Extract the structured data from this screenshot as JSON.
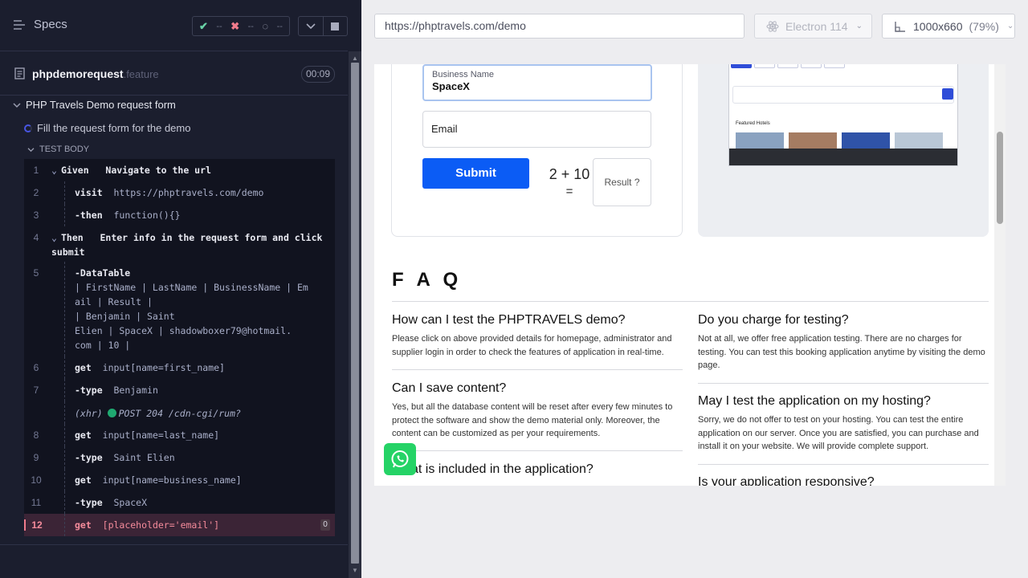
{
  "runner": {
    "specs_label": "Specs",
    "stats": {
      "passed": "--",
      "failed": "--",
      "pending": "--"
    },
    "spec": {
      "name": "phpdemorequest",
      "ext": ".feature",
      "time": "00:09"
    },
    "suite_title": "PHP Travels Demo request form",
    "test_title": "Fill the request form for the demo",
    "body_label": "TEST BODY",
    "commands": [
      {
        "num": "1",
        "kw": "Given",
        "text": "Navigate to the url"
      },
      {
        "num": "2",
        "kw": "visit",
        "text": "https://phptravels.com/demo"
      },
      {
        "num": "3",
        "kw": "-then",
        "text": "function(){}"
      },
      {
        "num": "4",
        "kw": "Then",
        "text": "Enter info in the request form and click",
        "text2": "submit"
      },
      {
        "num": "5",
        "kw": "-DataTable",
        "lines": [
          "| FirstName | LastName    | BusinessName | Em",
          "ail                      | Result |",
          "| Benjamin  | Saint",
          "Elien | SpaceX       | shadowboxer79@hotmail.",
          "com | 10     |"
        ]
      },
      {
        "num": "6",
        "kw": "get",
        "text": "input[name=first_name]"
      },
      {
        "num": "7",
        "kw": "-type",
        "text": "Benjamin"
      },
      {
        "num": "",
        "kw": "(xhr)",
        "text": "POST 204 /cdn-cgi/rum?"
      },
      {
        "num": "8",
        "kw": "get",
        "text": "input[name=last_name]"
      },
      {
        "num": "9",
        "kw": "-type",
        "text": "Saint Elien"
      },
      {
        "num": "10",
        "kw": "get",
        "text": "input[name=business_name]"
      },
      {
        "num": "11",
        "kw": "-type",
        "text": "SpaceX"
      },
      {
        "num": "12",
        "kw": "get",
        "text": "[placeholder='email']",
        "badge": "0"
      }
    ]
  },
  "aut": {
    "url": "https://phptravels.com/demo",
    "browser": "Electron 114",
    "viewport": "1000x660",
    "zoom": "(79%)",
    "form": {
      "business_label": "Business Name",
      "business_value": "SpaceX",
      "email_placeholder": "Email",
      "submit_label": "Submit",
      "captcha_top": "2 + 10",
      "captcha_eq": "=",
      "result_placeholder": "Result ?"
    },
    "preview": {
      "featured": "Featured Hotels"
    },
    "faq": {
      "title": "F A Q",
      "left": [
        {
          "q": "How can I test the PHPTRAVELS demo?",
          "a": "Please click on above provided details for homepage, administrator and supplier login in order to check the features of application in real-time."
        },
        {
          "q": "Can I save content?",
          "a": "Yes, but all the database content will be reset after every few minutes to protect the software and show the demo material only. Moreover, the content can be customized as per your requirements."
        },
        {
          "q": "What is included in the application?",
          "a": ""
        }
      ],
      "right": [
        {
          "q": "Do you charge for testing?",
          "a": "Not at all, we offer free application testing. There are no charges for testing. You can test this booking application anytime by visiting the demo page."
        },
        {
          "q": "May I test the application on my hosting?",
          "a": "Sorry, we do not offer to test on your hosting. You can test the entire application on our server. Once you are satisfied, you can purchase and install it on your website. We will provide complete support."
        },
        {
          "q": "Is your application responsive?",
          "a": ""
        }
      ]
    }
  }
}
